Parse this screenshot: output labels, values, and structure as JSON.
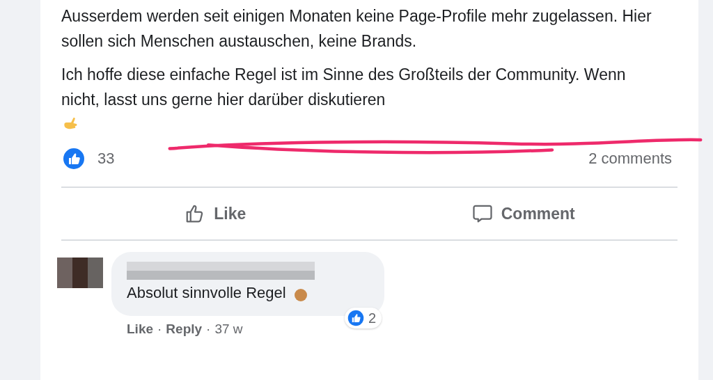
{
  "post": {
    "paragraphs": [
      "Ausserdem werden seit einigen Monaten keine Page-Profile mehr zugelassen. Hier sollen sich Menschen austauschen, keine Brands.",
      "Ich hoffe diese einfache Regel ist im Sinne des Großteils der Community. Wenn nicht, lasst uns gerne hier darüber diskutieren"
    ],
    "reaction_count": "33",
    "comments_count": "2 comments",
    "actions": [
      {
        "kind": "like",
        "label": "Like"
      },
      {
        "kind": "comment",
        "label": "Comment"
      }
    ]
  },
  "comment": {
    "text": "Absolut sinnvolle Regel",
    "reaction_count": "2",
    "links": [
      "Like",
      "Reply"
    ],
    "separator": "·",
    "time": "37 w"
  }
}
